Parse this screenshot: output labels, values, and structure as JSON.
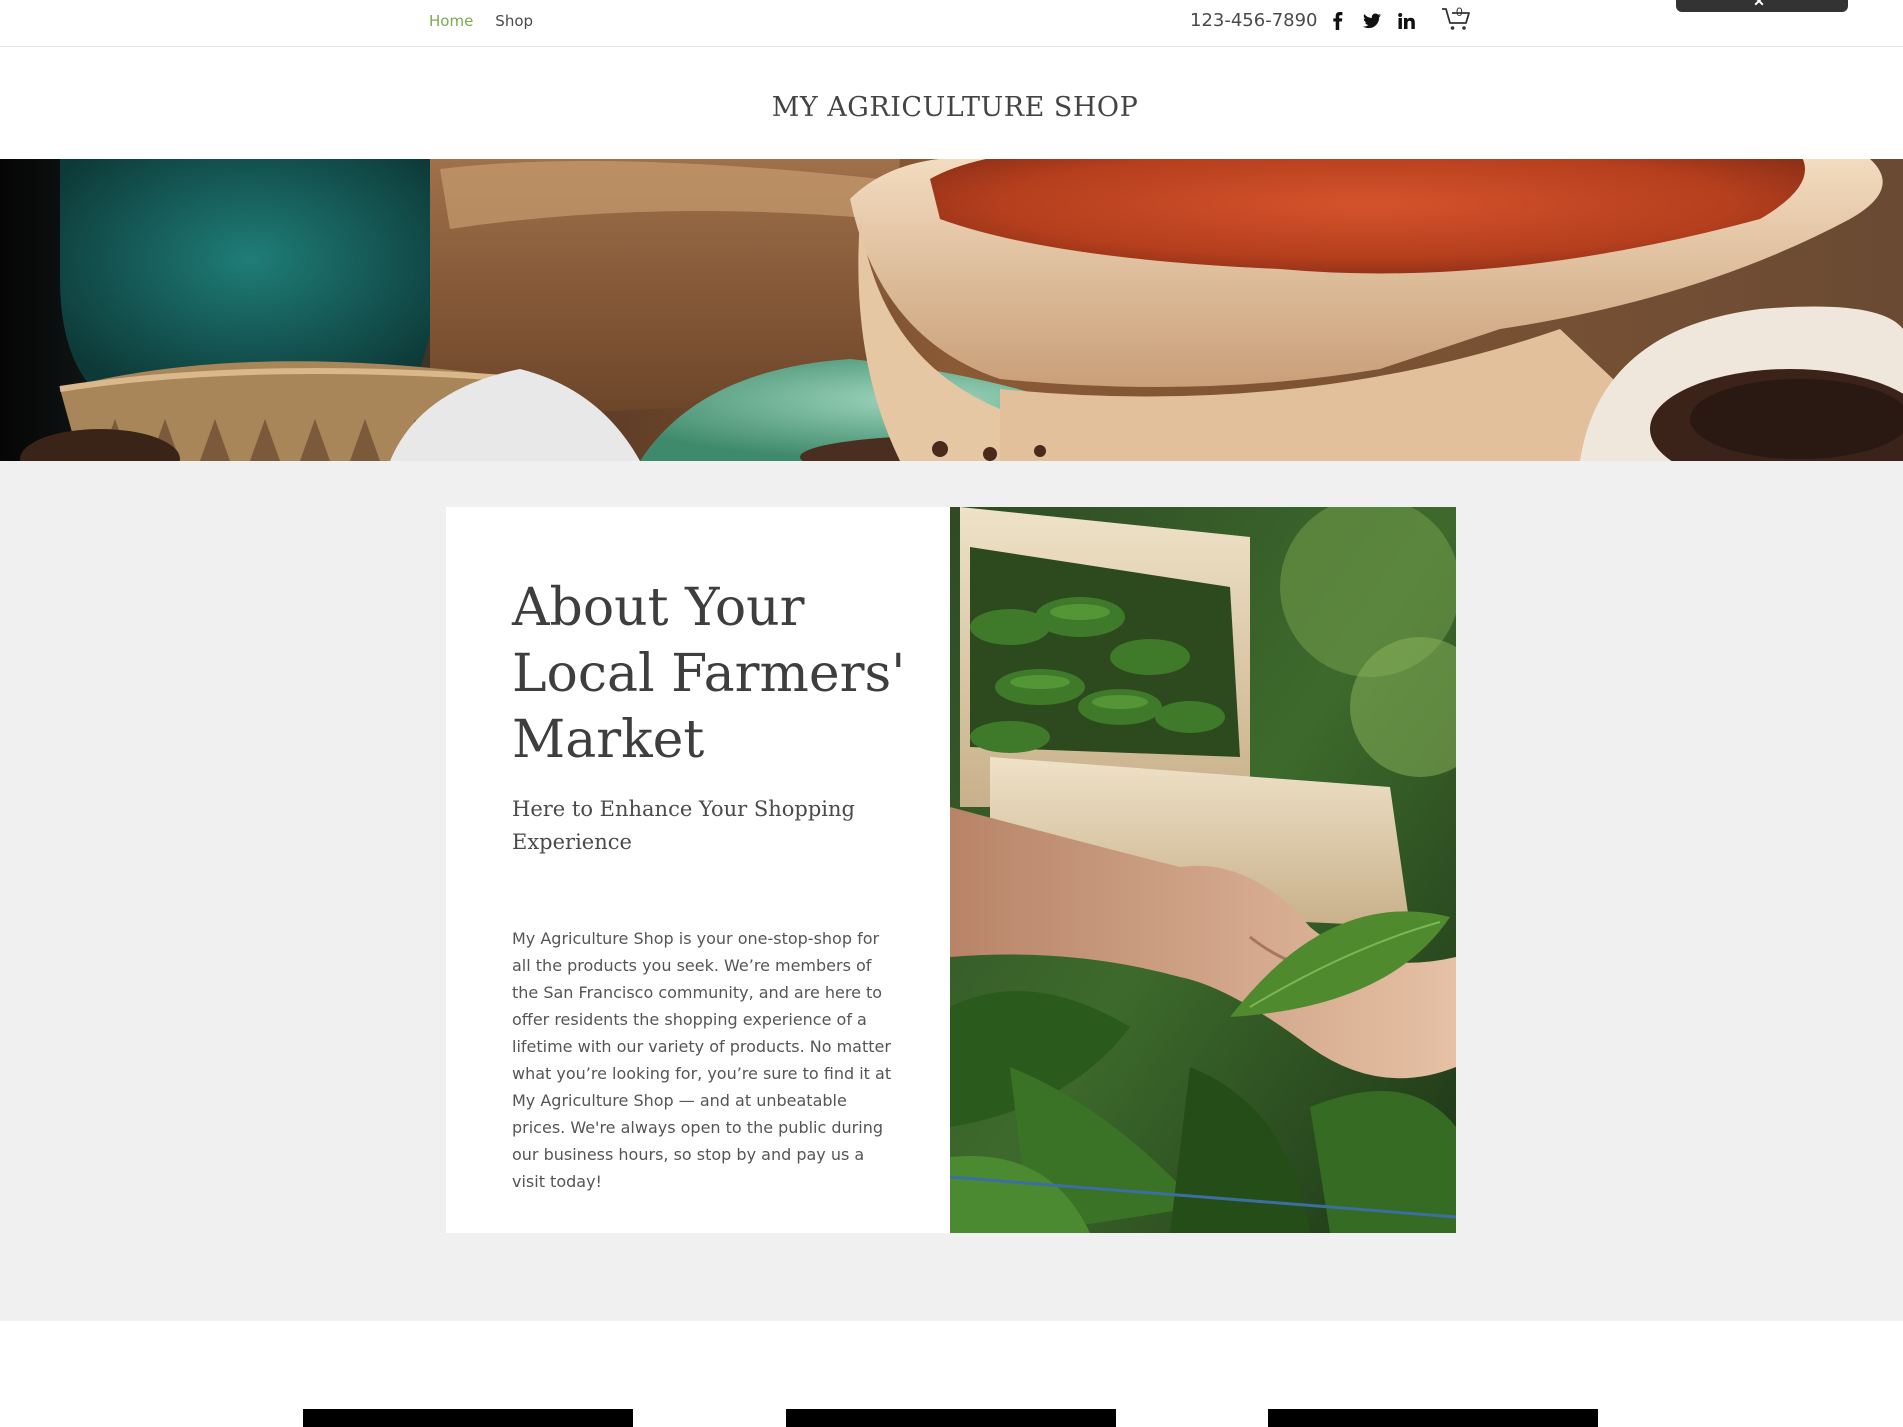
{
  "nav": {
    "items": [
      {
        "label": "Home",
        "active": true
      },
      {
        "label": "Shop",
        "active": false
      }
    ]
  },
  "contact": {
    "phone": "123-456-7890"
  },
  "social": {
    "icons": [
      "facebook-icon",
      "twitter-icon",
      "linkedin-icon"
    ]
  },
  "cart": {
    "count": "0",
    "icon": "cart-icon"
  },
  "site": {
    "title": "MY AGRICULTURE SHOP"
  },
  "about": {
    "heading": "About Your Local Farmers' Market",
    "subheading": "Here to Enhance Your Shopping Experience",
    "body": "My Agriculture Shop is your one-stop-shop for all the products you seek. We’re members of the San Francisco community, and are here to offer residents the shopping experience of a lifetime with our variety of products. No matter what you’re looking for, you’re sure to find it at My Agriculture Shop — and at unbeatable prices. We're always open to the public during our business hours, so stop by and pay us a visit today!"
  },
  "colors": {
    "nav_active": "#7aab4f",
    "section_bg": "#f0f0f0",
    "text_dark": "#3e3e3e"
  }
}
